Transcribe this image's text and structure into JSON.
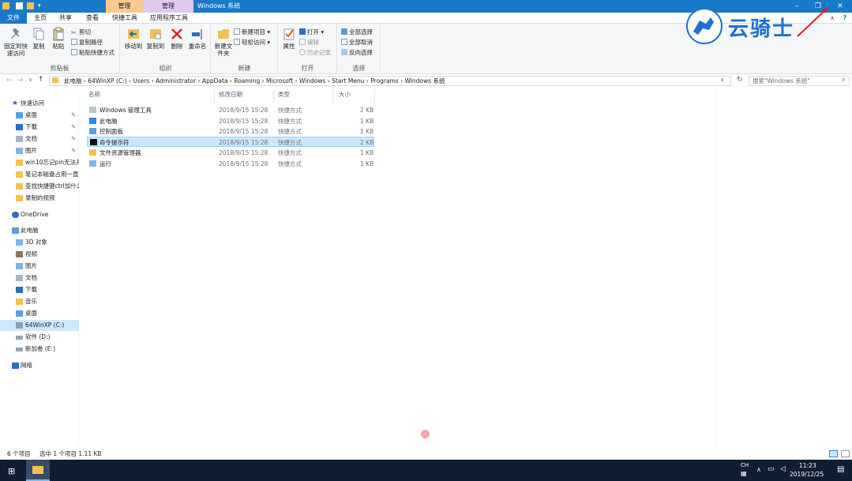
{
  "window": {
    "title": "Windows 系统",
    "context_tabs": [
      "管理",
      "管理"
    ],
    "context_tab_subs": [
      "",
      "应用程序工具"
    ]
  },
  "tabs": [
    "文件",
    "主页",
    "共享",
    "查看",
    "快捷工具",
    "应用程序工具"
  ],
  "ribbon": {
    "clipboard": {
      "label": "剪贴板",
      "pin": "固定到快速访问",
      "copy": "复制",
      "paste": "粘贴",
      "cut": "剪切",
      "copy_path": "复制路径",
      "paste_shortcut": "粘贴快捷方式"
    },
    "organize": {
      "label": "组织",
      "move_to": "移动到",
      "copy_to": "复制到",
      "delete": "删除",
      "rename": "重命名"
    },
    "new": {
      "label": "新建",
      "new_folder": "新建文件夹",
      "new_item": "新建项目",
      "easy_access": "轻松访问"
    },
    "open": {
      "label": "打开",
      "properties": "属性",
      "open": "打开",
      "edit": "编辑",
      "history": "历史记录"
    },
    "select": {
      "label": "选择",
      "select_all": "全部选择",
      "select_none": "全部取消",
      "invert": "反向选择"
    }
  },
  "address": {
    "path": "此电脑  ›  64WinXP (C:)  ›  Users  ›  Administrator  ›  AppData  ›  Roaming  ›  Microsoft  ›  Windows  ›  Start Menu  ›  Programs  ›  Windows 系统",
    "search_placeholder": "搜索\"Windows 系统\""
  },
  "nav": {
    "quick_access": "快速访问",
    "quick_items": [
      "桌面",
      "下载",
      "文档",
      "图片",
      "win10忘记pin无法开",
      "笔记本磁盘占用一直",
      "查找快捷键ctrl加什么",
      "录制的视频"
    ],
    "onedrive": "OneDrive",
    "this_pc": "此电脑",
    "pc_items": [
      "3D 对象",
      "视频",
      "图片",
      "文档",
      "下载",
      "音乐",
      "桌面",
      "64WinXP  (C:)",
      "软件 (D:)",
      "新加卷 (E:)"
    ],
    "network": "网络"
  },
  "columns": [
    "名称",
    "修改日期",
    "类型",
    "大小"
  ],
  "files": [
    {
      "name": "Windows 管理工具",
      "date": "2018/9/15 15:28",
      "type": "快捷方式",
      "size": "2 KB"
    },
    {
      "name": "此电脑",
      "date": "2018/9/15 15:28",
      "type": "快捷方式",
      "size": "1 KB"
    },
    {
      "name": "控制面板",
      "date": "2018/9/15 15:28",
      "type": "快捷方式",
      "size": "1 KB"
    },
    {
      "name": "命令提示符",
      "date": "2018/9/15 15:28",
      "type": "快捷方式",
      "size": "2 KB"
    },
    {
      "name": "文件资源管理器",
      "date": "2018/9/15 15:28",
      "type": "快捷方式",
      "size": "1 KB"
    },
    {
      "name": "运行",
      "date": "2018/9/15 15:28",
      "type": "快捷方式",
      "size": "1 KB"
    }
  ],
  "status": {
    "count": "6 个项目",
    "selection": "选中 1 个项目  1.11 KB"
  },
  "taskbar": {
    "ime": "CH",
    "time": "11:23",
    "date": "2019/12/25"
  },
  "watermark": "云骑士",
  "colors": {
    "accent": "#1979ca",
    "selection": "#cce8ff",
    "taskbar": "#101e32",
    "folder": "#f2c24e"
  }
}
